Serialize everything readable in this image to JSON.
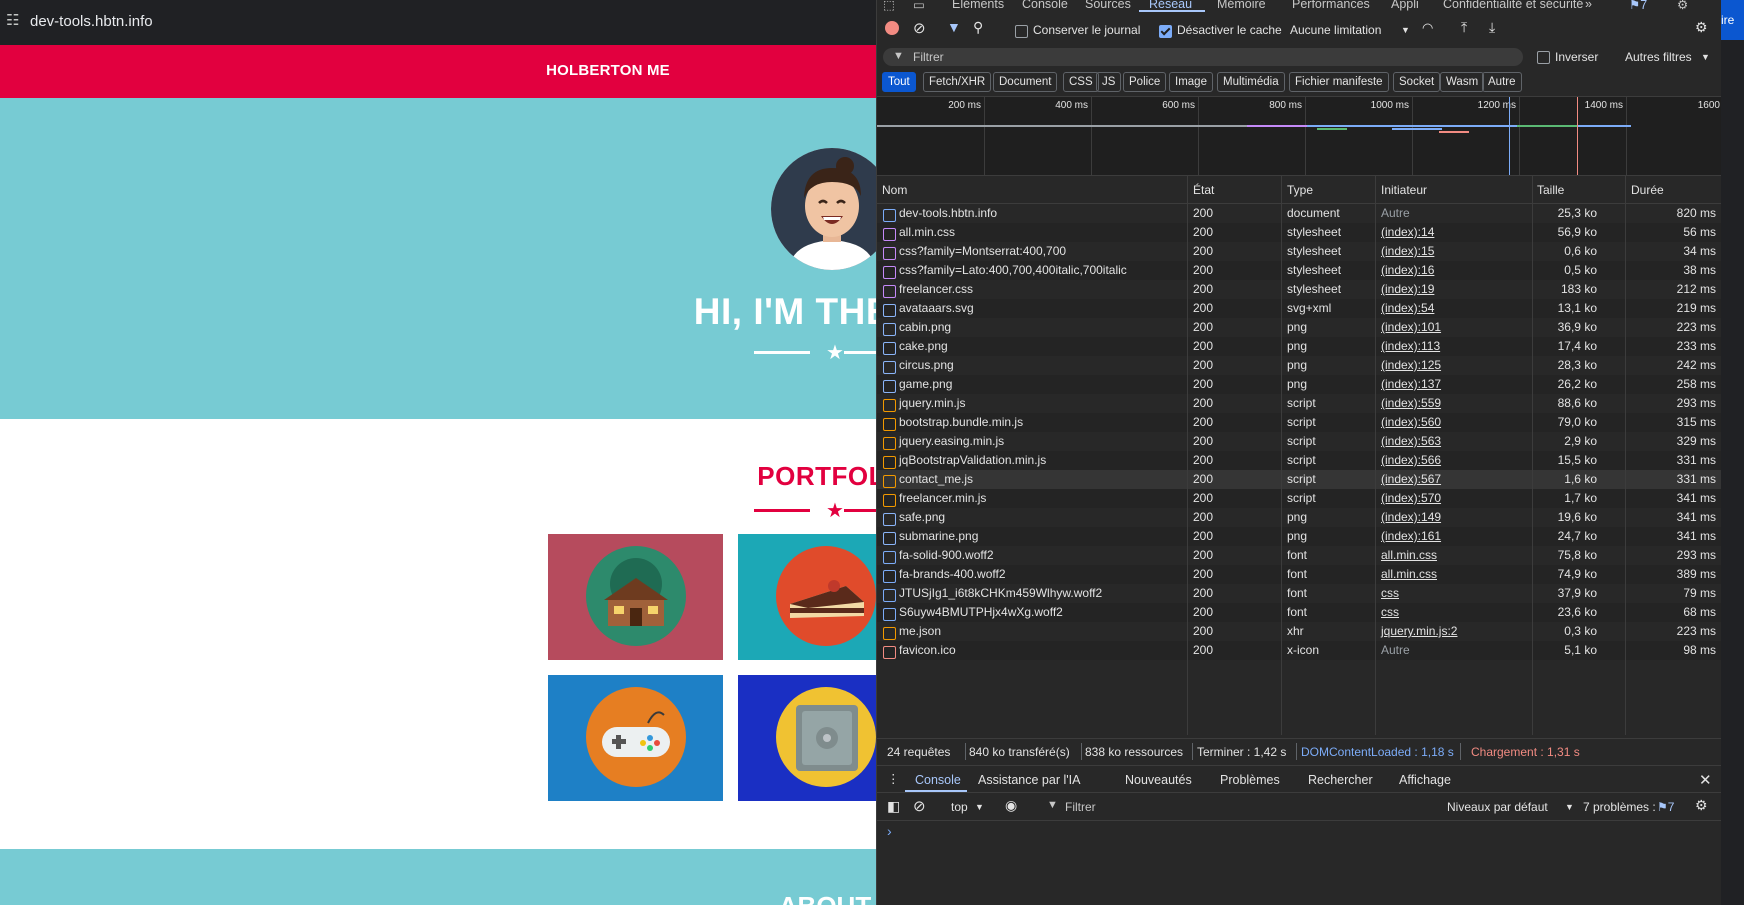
{
  "browser": {
    "url": "dev-tools.hbtn.info"
  },
  "site": {
    "brand": "HOLBERTON ME",
    "hero_title": "HI, I'M THE CH",
    "portfolio_title": "PORTFOLI",
    "about_title": "ABOUT",
    "colors": {
      "nav": "#e2003f",
      "hero": "#77cbd3"
    }
  },
  "devtools": {
    "panel_tabs": [
      "Éléments",
      "Console",
      "Sources",
      "Réseau",
      "Mémoire",
      "Performances",
      "Appli",
      "Confidentialité et sécurité"
    ],
    "active_tab": "Réseau",
    "more_tabs": "»",
    "issues_badge": "7",
    "toolbar": {
      "preserve_log": "Conserver le journal",
      "disable_cache": "Désactiver le cache",
      "throttling": "Aucune limitation"
    },
    "filter": {
      "placeholder": "Filtrer",
      "invert": "Inverser",
      "other_filters": "Autres filtres"
    },
    "type_filters": [
      "Tout",
      "Fetch/XHR",
      "Document",
      "CSS",
      "JS",
      "Police",
      "Image",
      "Multimédia",
      "Fichier manifeste",
      "Socket",
      "Wasm",
      "Autre"
    ],
    "overview_ticks": [
      "200 ms",
      "400 ms",
      "600 ms",
      "800 ms",
      "1000 ms",
      "1200 ms",
      "1400 ms",
      "1600"
    ],
    "columns": [
      "Nom",
      "État",
      "Type",
      "Initiateur",
      "Taille",
      "Durée"
    ],
    "requests": [
      {
        "name": "dev-tools.hbtn.info",
        "status": "200",
        "type": "document",
        "initiator": "Autre",
        "size": "25,3 ko",
        "time": "820 ms",
        "icon": "document-icon"
      },
      {
        "name": "all.min.css",
        "status": "200",
        "type": "stylesheet",
        "initiator": "(index):14",
        "size": "56,9 ko",
        "time": "56 ms",
        "icon": "stylesheet-icon"
      },
      {
        "name": "css?family=Montserrat:400,700",
        "status": "200",
        "type": "stylesheet",
        "initiator": "(index):15",
        "size": "0,6 ko",
        "time": "34 ms",
        "icon": "stylesheet-icon"
      },
      {
        "name": "css?family=Lato:400,700,400italic,700italic",
        "status": "200",
        "type": "stylesheet",
        "initiator": "(index):16",
        "size": "0,5 ko",
        "time": "38 ms",
        "icon": "stylesheet-icon"
      },
      {
        "name": "freelancer.css",
        "status": "200",
        "type": "stylesheet",
        "initiator": "(index):19",
        "size": "183 ko",
        "time": "212 ms",
        "icon": "stylesheet-icon"
      },
      {
        "name": "avataaars.svg",
        "status": "200",
        "type": "svg+xml",
        "initiator": "(index):54",
        "size": "13,1 ko",
        "time": "219 ms",
        "icon": "image-icon"
      },
      {
        "name": "cabin.png",
        "status": "200",
        "type": "png",
        "initiator": "(index):101",
        "size": "36,9 ko",
        "time": "223 ms",
        "icon": "image-icon"
      },
      {
        "name": "cake.png",
        "status": "200",
        "type": "png",
        "initiator": "(index):113",
        "size": "17,4 ko",
        "time": "233 ms",
        "icon": "image-icon"
      },
      {
        "name": "circus.png",
        "status": "200",
        "type": "png",
        "initiator": "(index):125",
        "size": "28,3 ko",
        "time": "242 ms",
        "icon": "image-icon"
      },
      {
        "name": "game.png",
        "status": "200",
        "type": "png",
        "initiator": "(index):137",
        "size": "26,2 ko",
        "time": "258 ms",
        "icon": "image-icon"
      },
      {
        "name": "jquery.min.js",
        "status": "200",
        "type": "script",
        "initiator": "(index):559",
        "size": "88,6 ko",
        "time": "293 ms",
        "icon": "script-icon"
      },
      {
        "name": "bootstrap.bundle.min.js",
        "status": "200",
        "type": "script",
        "initiator": "(index):560",
        "size": "79,0 ko",
        "time": "315 ms",
        "icon": "script-icon"
      },
      {
        "name": "jquery.easing.min.js",
        "status": "200",
        "type": "script",
        "initiator": "(index):563",
        "size": "2,9 ko",
        "time": "329 ms",
        "icon": "script-icon"
      },
      {
        "name": "jqBootstrapValidation.min.js",
        "status": "200",
        "type": "script",
        "initiator": "(index):566",
        "size": "15,5 ko",
        "time": "331 ms",
        "icon": "script-icon"
      },
      {
        "name": "contact_me.js",
        "status": "200",
        "type": "script",
        "initiator": "(index):567",
        "size": "1,6 ko",
        "time": "331 ms",
        "icon": "script-icon"
      },
      {
        "name": "freelancer.min.js",
        "status": "200",
        "type": "script",
        "initiator": "(index):570",
        "size": "1,7 ko",
        "time": "341 ms",
        "icon": "script-icon"
      },
      {
        "name": "safe.png",
        "status": "200",
        "type": "png",
        "initiator": "(index):149",
        "size": "19,6 ko",
        "time": "341 ms",
        "icon": "image-icon"
      },
      {
        "name": "submarine.png",
        "status": "200",
        "type": "png",
        "initiator": "(index):161",
        "size": "24,7 ko",
        "time": "341 ms",
        "icon": "image-icon"
      },
      {
        "name": "fa-solid-900.woff2",
        "status": "200",
        "type": "font",
        "initiator": "all.min.css",
        "size": "75,8 ko",
        "time": "293 ms",
        "icon": "font-icon"
      },
      {
        "name": "fa-brands-400.woff2",
        "status": "200",
        "type": "font",
        "initiator": "all.min.css",
        "size": "74,9 ko",
        "time": "389 ms",
        "icon": "font-icon"
      },
      {
        "name": "JTUSjIg1_i6t8kCHKm459Wlhyw.woff2",
        "status": "200",
        "type": "font",
        "initiator": "css",
        "size": "37,9 ko",
        "time": "79 ms",
        "icon": "font-icon"
      },
      {
        "name": "S6uyw4BMUTPHjx4wXg.woff2",
        "status": "200",
        "type": "font",
        "initiator": "css",
        "size": "23,6 ko",
        "time": "68 ms",
        "icon": "font-icon"
      },
      {
        "name": "me.json",
        "status": "200",
        "type": "xhr",
        "initiator": "jquery.min.js:2",
        "size": "0,3 ko",
        "time": "223 ms",
        "icon": "xhr-icon"
      },
      {
        "name": "favicon.ico",
        "status": "200",
        "type": "x-icon",
        "initiator": "Autre",
        "size": "5,1 ko",
        "time": "98 ms",
        "icon": "favicon-icon"
      }
    ],
    "summary": {
      "requests": "24 requêtes",
      "transferred": "840 ko transféré(s)",
      "resources": "838 ko ressources",
      "finish": "Terminer : 1,42 s",
      "dcl": "DOMContentLoaded : 1,18 s",
      "load": "Chargement : 1,31 s"
    },
    "drawer_tabs": [
      "Console",
      "Assistance par l'IA",
      "Nouveautés",
      "Problèmes",
      "Rechercher",
      "Affichage"
    ],
    "console": {
      "context": "top",
      "filter_placeholder": "Filtrer",
      "levels": "Niveaux par défaut",
      "problems": "7 problèmes :",
      "problems_count": "7",
      "prompt": "›"
    }
  }
}
